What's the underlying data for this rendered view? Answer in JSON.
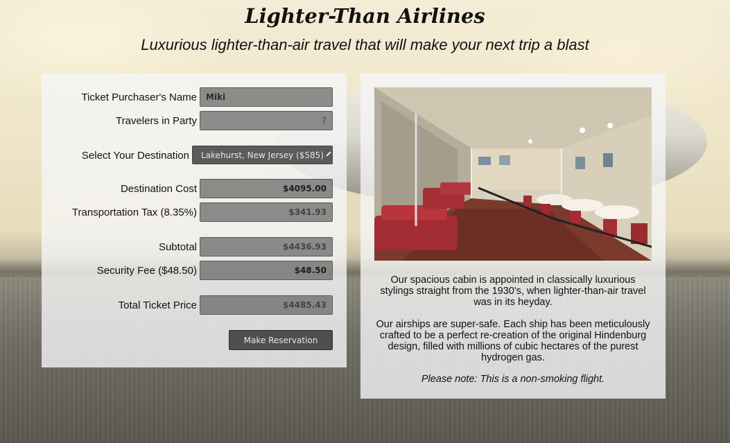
{
  "header": {
    "title": "Lighter-Than Airlines",
    "subtitle": "Luxurious lighter-than-air travel that will make your next trip a blast"
  },
  "form": {
    "purchaser": {
      "label": "Ticket Purchaser's Name",
      "value": "Miki"
    },
    "travelers": {
      "label": "Travelers in Party",
      "value": "7"
    },
    "destination": {
      "label": "Select Your Destination",
      "selected": "Lakehurst, New Jersey ($585)"
    },
    "destination_cost": {
      "label": "Destination Cost",
      "value": "$4095.00"
    },
    "tax": {
      "label": "Transportation Tax (8.35%)",
      "value": "$341.93"
    },
    "subtotal": {
      "label": "Subtotal",
      "value": "$4436.93"
    },
    "security_fee": {
      "label": "Security Fee ($48.50)",
      "value": "$48.50"
    },
    "total": {
      "label": "Total Ticket Price",
      "value": "$4485.43"
    },
    "submit_label": "Make Reservation"
  },
  "info": {
    "paragraph1": "Our spacious cabin is appointed in classically luxurious stylings straight from the 1930's, when lighter-than-air travel was in its heyday.",
    "paragraph2": "Our airships are super-safe. Each ship has been meticulously crafted to be a perfect re-creation of the original Hindenburg design, filled with millions of cubic hectares of the purest hydrogen gas.",
    "note": "Please note: This is a non-smoking flight."
  },
  "icons": {
    "select_chevron": "chevron-down-icon"
  },
  "colors": {
    "panel_bg": "#f5f5f5",
    "field_bg": "#646464",
    "button_bg": "#4e4e4e"
  }
}
